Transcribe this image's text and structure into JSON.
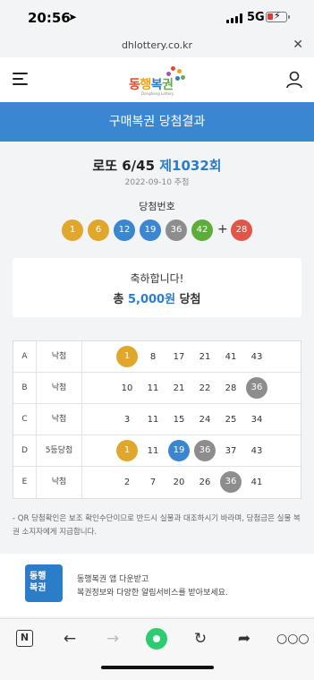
{
  "status": {
    "time": "20:56",
    "network": "5G"
  },
  "url": {
    "domain": "dhlottery.co.kr"
  },
  "header": {
    "logo_text": [
      "동",
      "행",
      "복",
      "권"
    ],
    "logo_sub": "Donghang Lottery"
  },
  "page_title": "구매복권 당첨결과",
  "game": {
    "name": "로또 6/45",
    "round": "제1032회",
    "draw_date": "2022-09-10 추첨",
    "winning_label": "당첨번호"
  },
  "winning_numbers": [
    "1",
    "6",
    "12",
    "19",
    "36",
    "42"
  ],
  "bonus_number": "28",
  "plus_sign": "+",
  "result": {
    "congrats": "축하합니다!",
    "prize_prefix": "총",
    "prize_amount": "5,000원",
    "prize_suffix": "당첨"
  },
  "tickets": [
    {
      "letter": "A",
      "result": "낙첨",
      "numbers": [
        "1",
        "8",
        "17",
        "21",
        "41",
        "43"
      ]
    },
    {
      "letter": "B",
      "result": "낙첨",
      "numbers": [
        "10",
        "11",
        "21",
        "22",
        "28",
        "36"
      ]
    },
    {
      "letter": "C",
      "result": "낙첨",
      "numbers": [
        "3",
        "11",
        "15",
        "24",
        "25",
        "34"
      ]
    },
    {
      "letter": "D",
      "result": "5등당첨",
      "numbers": [
        "1",
        "11",
        "19",
        "36",
        "37",
        "43"
      ]
    },
    {
      "letter": "E",
      "result": "낙첨",
      "numbers": [
        "2",
        "7",
        "20",
        "26",
        "36",
        "41"
      ]
    }
  ],
  "note": "- QR 당첨확인은 보조 확인수단이므로 반드시 실물과 대조하시기 바라며, 당첨금은 실물 복권 소지자에게 지급합니다.",
  "promo": {
    "logo_line1": "동행",
    "logo_line2": "복권",
    "line1": "동행복권 앱 다운받고",
    "line2": "복권정보와 다양한 알림서비스를 받아보세요."
  },
  "browser": {
    "n_label": "N"
  },
  "colors": {
    "yellow": "#e0a72c",
    "blue": "#3b86d1",
    "gray": "#8d8d8d",
    "green": "#5dad3b",
    "red": "#e0574a",
    "banner": "#3b86d1"
  }
}
